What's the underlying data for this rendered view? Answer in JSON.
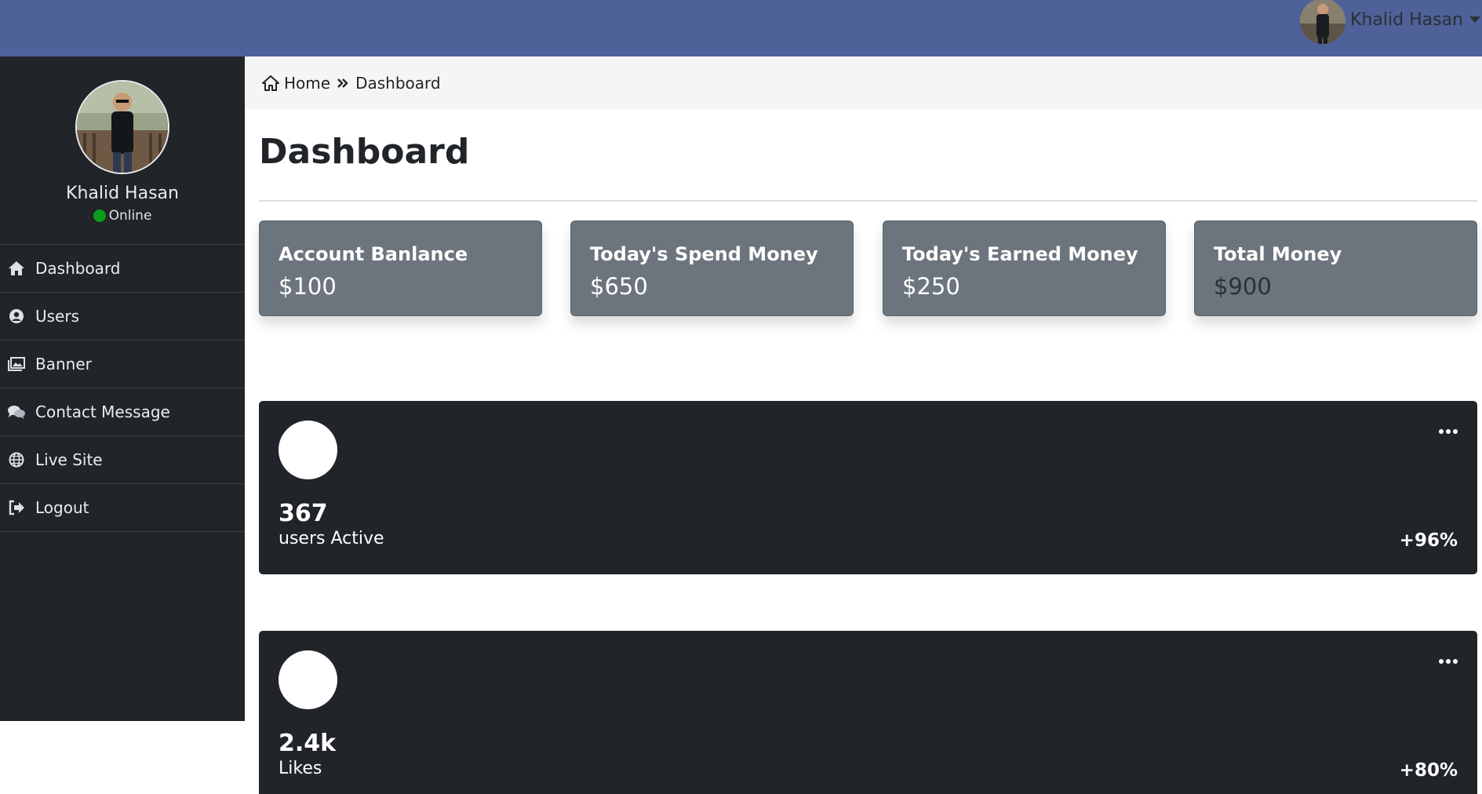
{
  "header": {
    "user_name": "Khalid Hasan",
    "bg_color": "#4e6199"
  },
  "sidebar": {
    "profile": {
      "name": "Khalid Hasan",
      "status": "Online",
      "status_color": "#0a9c1a"
    },
    "items": [
      {
        "label": "Dashboard",
        "icon": "home-icon"
      },
      {
        "label": "Users",
        "icon": "user-circle-icon"
      },
      {
        "label": "Banner",
        "icon": "images-icon"
      },
      {
        "label": "Contact Message",
        "icon": "comments-icon"
      },
      {
        "label": "Live Site",
        "icon": "globe-icon"
      },
      {
        "label": "Logout",
        "icon": "sign-out-icon"
      }
    ]
  },
  "breadcrumb": {
    "home": "Home",
    "current": "Dashboard"
  },
  "page": {
    "title": "Dashboard"
  },
  "stats": [
    {
      "title": "Account Banlance",
      "value": "$100"
    },
    {
      "title": "Today's Spend Money",
      "value": "$650"
    },
    {
      "title": "Today's Earned Money",
      "value": "$250"
    },
    {
      "title": "Total Money",
      "value": "$900"
    }
  ],
  "metrics": [
    {
      "value": "367",
      "label": "users Active",
      "change": "+96%"
    },
    {
      "value": "2.4k",
      "label": "Likes",
      "change": "+80%"
    }
  ]
}
